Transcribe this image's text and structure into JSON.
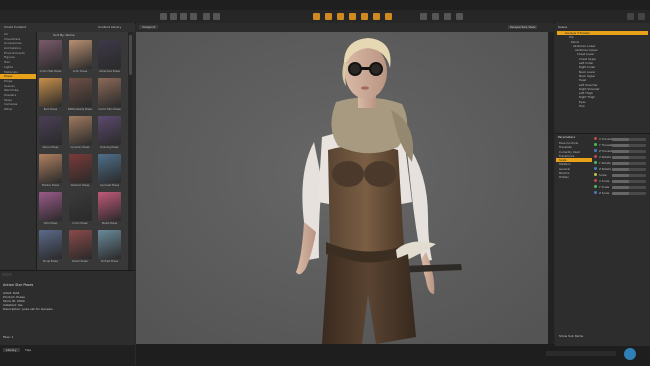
{
  "menubar": {
    "items": [
      "File",
      "Edit",
      "Create",
      "Window",
      "Help"
    ]
  },
  "left_panel": {
    "tabs": [
      "Smart Content",
      "Content Library"
    ],
    "categories": [
      "All",
      "Characters",
      "Accessories",
      "Animations",
      "Environments",
      "Figures",
      "Hair",
      "Lights",
      "Materials",
      "Poses",
      "Props",
      "Scenes",
      "Wardrobe",
      "Shaders",
      "Skies",
      "Cameras",
      "Other"
    ],
    "selected_category": "Poses",
    "grid_header": "Sort By: Name",
    "products": [
      {
        "caption": "Action Star Poses"
      },
      {
        "caption": "Actor Poses"
      },
      {
        "caption": "Adventure Poses"
      },
      {
        "caption": "Bold Poses"
      },
      {
        "caption": "Battle Ready Poses"
      },
      {
        "caption": "Comic Hero Poses"
      },
      {
        "caption": "Dance Poses"
      },
      {
        "caption": "Dynamic Poses"
      },
      {
        "caption": "Evening Poses"
      },
      {
        "caption": "Fashion Poses"
      },
      {
        "caption": "Glamour Poses"
      },
      {
        "caption": "Gymnast Poses"
      },
      {
        "caption": "Hero Poses"
      },
      {
        "caption": "Iconic Poses"
      },
      {
        "caption": "Model Poses"
      },
      {
        "caption": "Pinup Poses"
      },
      {
        "caption": "Power Poses"
      },
      {
        "caption": "Portrait Poses"
      }
    ],
    "info": {
      "title": "Action Star Poses",
      "rows": [
        "Artist: DAZ",
        "Product: Poses",
        "Store ID: 0000",
        "Installed: Yes",
        "Description: pose set for Genesis"
      ],
      "footer": "Files: 1"
    },
    "bottom_tabs": [
      "Library",
      "Tips"
    ]
  },
  "viewport": {
    "tab": "Viewport",
    "camera_label": "Perspective View"
  },
  "scene": {
    "title": "Scene",
    "rows": [
      "Genesis 3 Female",
      "Hip",
      "Pelvis",
      "Abdomen Lower",
      "Abdomen Upper",
      "Chest Lower",
      "Chest Upper",
      "Left Collar",
      "Right Collar",
      "Neck Lower",
      "Neck Upper",
      "Head",
      "Left Shoulder",
      "Right Shoulder",
      "Left Thigh",
      "Right Thigh",
      "Eyes",
      "Hair"
    ],
    "selected": "Genesis 3 Female"
  },
  "params": {
    "title": "Parameters",
    "tree": [
      "Pose Controls",
      "Translate",
      "Currently Used",
      "Transforms",
      "Scale",
      "Rotation",
      "General",
      "Morphs",
      "Hidden"
    ],
    "rows": [
      {
        "label": "X Translate",
        "level": 0.5
      },
      {
        "label": "Y Translate",
        "level": 0.5
      },
      {
        "label": "Z Translate",
        "level": 0.5
      },
      {
        "label": "X Rotate",
        "level": 0.5
      },
      {
        "label": "Y Rotate",
        "level": 0.5
      },
      {
        "label": "Z Rotate",
        "level": 0.5
      },
      {
        "label": "Scale",
        "level": 0.5
      },
      {
        "label": "X Scale",
        "level": 0.5
      },
      {
        "label": "Y Scale",
        "level": 0.5
      },
      {
        "label": "Z Scale",
        "level": 0.5
      }
    ],
    "footer": "Show Sub Items"
  },
  "colors": {
    "accent": "#e8a21a",
    "viewport_bg": "#5d5d5d"
  }
}
